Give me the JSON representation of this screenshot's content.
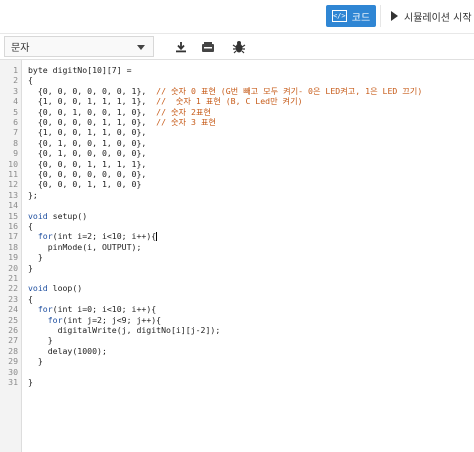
{
  "header": {
    "code_button_label": "코드",
    "code_icon_glyph": "</>",
    "simulation_button_label": "시뮬레이션 시작"
  },
  "toolbar": {
    "mode_select_value": "문자",
    "icons": [
      "download-icon",
      "upload-device-icon",
      "debug-bug-icon"
    ]
  },
  "editor": {
    "line_numbers": [
      "1",
      "2",
      "3",
      "4",
      "5",
      "6",
      "7",
      "8",
      "9",
      "10",
      "11",
      "12",
      "13",
      "14",
      "15",
      "16",
      "17",
      "18",
      "19",
      "20",
      "21",
      "22",
      "23",
      "24",
      "25",
      "26",
      "27",
      "28",
      "29",
      "30",
      "31"
    ],
    "lines": [
      [
        {
          "t": "byte digitNo[10][7] ="
        }
      ],
      [
        {
          "t": "{"
        }
      ],
      [
        {
          "t": "  {0, 0, 0, 0, 0, 0, 1},  "
        },
        {
          "t": "// 숫자 0 표현 (G번 빼고 모두 켜기- 0은 LED켜고, 1은 LED 끄기)",
          "c": "cm"
        }
      ],
      [
        {
          "t": "  {1, 0, 0, 1, 1, 1, 1},  "
        },
        {
          "t": "//  숫자 1 표현 (B, C Led만 켜기)",
          "c": "cm"
        }
      ],
      [
        {
          "t": "  {0, 0, 1, 0, 0, 1, 0},  "
        },
        {
          "t": "// 숫자 2표현",
          "c": "cm"
        }
      ],
      [
        {
          "t": "  {0, 0, 0, 0, 1, 1, 0},  "
        },
        {
          "t": "// 숫자 3 표현",
          "c": "cm"
        }
      ],
      [
        {
          "t": "  {1, 0, 0, 1, 1, 0, 0},"
        }
      ],
      [
        {
          "t": "  {0, 1, 0, 0, 1, 0, 0},"
        }
      ],
      [
        {
          "t": "  {0, 1, 0, 0, 0, 0, 0},"
        }
      ],
      [
        {
          "t": "  {0, 0, 0, 1, 1, 1, 1},"
        }
      ],
      [
        {
          "t": "  {0, 0, 0, 0, 0, 0, 0},"
        }
      ],
      [
        {
          "t": "  {0, 0, 0, 1, 1, 0, 0}"
        }
      ],
      [
        {
          "t": "};"
        }
      ],
      [
        {
          "t": ""
        }
      ],
      [
        {
          "t": "void",
          "c": "kw"
        },
        {
          "t": " setup()"
        }
      ],
      [
        {
          "t": "{"
        }
      ],
      [
        {
          "t": "  "
        },
        {
          "t": "for",
          "c": "kw"
        },
        {
          "t": "(int i=2; i<10; i++){",
          "cursor": true
        }
      ],
      [
        {
          "t": "    pinMode(i, OUTPUT);"
        }
      ],
      [
        {
          "t": "  }"
        }
      ],
      [
        {
          "t": "}"
        }
      ],
      [
        {
          "t": ""
        }
      ],
      [
        {
          "t": "void",
          "c": "kw"
        },
        {
          "t": " loop()"
        }
      ],
      [
        {
          "t": "{"
        }
      ],
      [
        {
          "t": "  "
        },
        {
          "t": "for",
          "c": "kw"
        },
        {
          "t": "(int i=0; i<10; i++){"
        }
      ],
      [
        {
          "t": "    "
        },
        {
          "t": "for",
          "c": "kw"
        },
        {
          "t": "(int j=2; j<9; j++){"
        }
      ],
      [
        {
          "t": "      digitalWrite(j, digitNo[i][j-2]);"
        }
      ],
      [
        {
          "t": "    }"
        }
      ],
      [
        {
          "t": "    delay(1000);"
        }
      ],
      [
        {
          "t": "  }"
        }
      ],
      [
        {
          "t": ""
        }
      ],
      [
        {
          "t": "}"
        }
      ]
    ]
  },
  "colors": {
    "accent": "#2f86d4",
    "keyword": "#1f4fa0",
    "comment": "#c75c1a",
    "gutter_bg": "#f3f3f3"
  }
}
